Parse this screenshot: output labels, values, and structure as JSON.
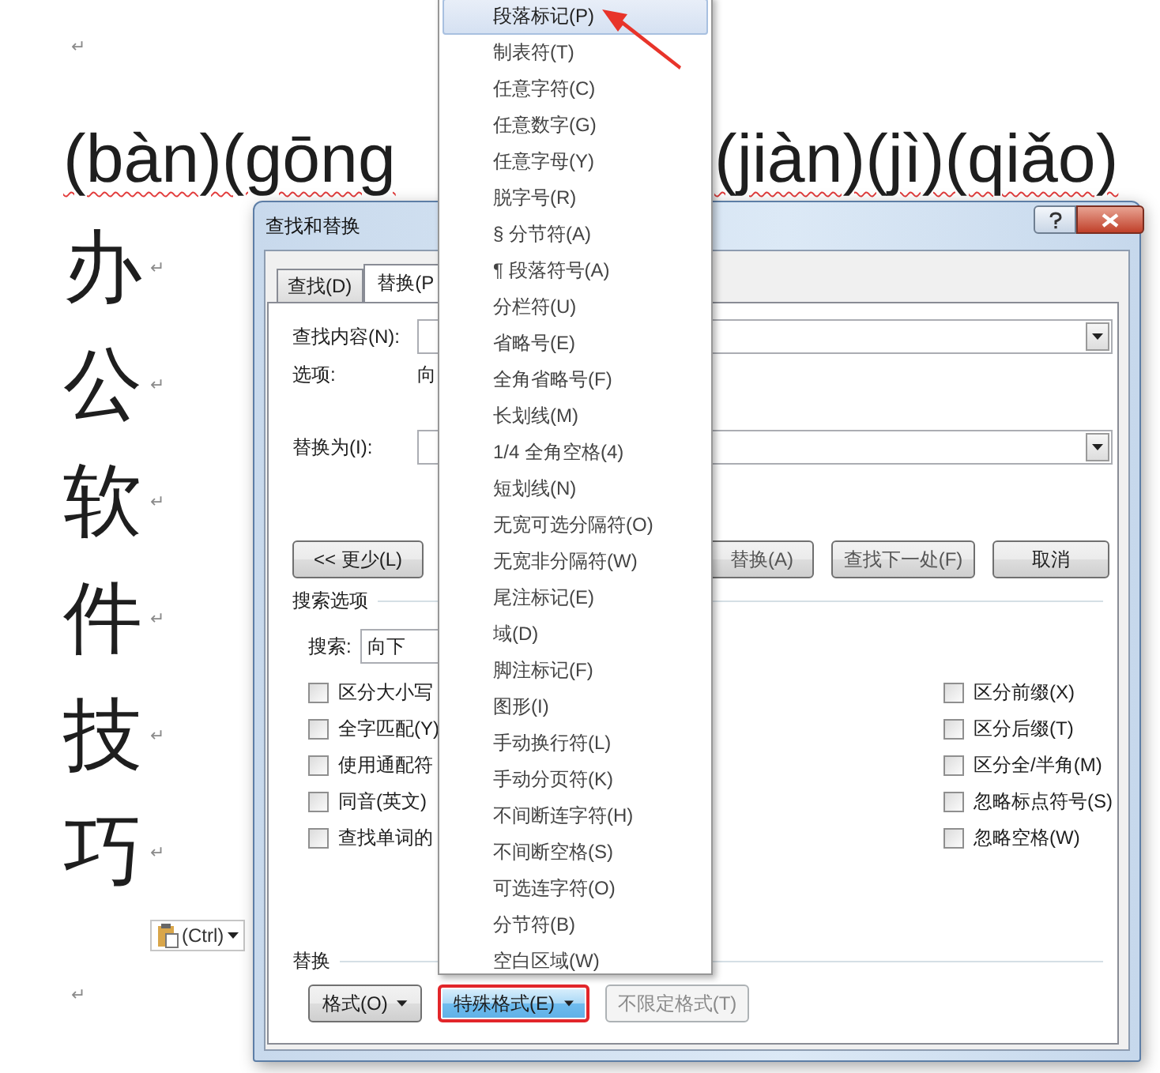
{
  "document": {
    "lines": [
      {
        "kind": "mark",
        "mark": "↵"
      },
      {
        "kind": "pinyin",
        "segments": [
          "(bàn)(gōng",
          "(jiàn)(jì)(qiǎo)"
        ]
      },
      {
        "kind": "char",
        "text": "办",
        "mark": "↵"
      },
      {
        "kind": "char",
        "text": "公",
        "mark": "↵"
      },
      {
        "kind": "char",
        "text": "软",
        "mark": "↵"
      },
      {
        "kind": "char",
        "text": "件",
        "mark": "↵"
      },
      {
        "kind": "char",
        "text": "技",
        "mark": "↵"
      },
      {
        "kind": "char",
        "text": "巧",
        "mark": "↵"
      },
      {
        "kind": "mark",
        "mark": "↵"
      }
    ],
    "paste_options": {
      "label": "(Ctrl)"
    }
  },
  "dialog": {
    "title": "查找和替换",
    "tabs": [
      {
        "label": "查找(D)",
        "selected": false
      },
      {
        "label": "替换(P",
        "selected": true
      }
    ],
    "find": {
      "label": "查找内容(N):"
    },
    "options": {
      "label": "选项:",
      "value": "向"
    },
    "replace": {
      "label": "替换为(I):"
    },
    "buttons": [
      {
        "label": "<< 更少(L)"
      },
      {
        "label": "替换(A)"
      },
      {
        "label": "查找下一处(F)"
      },
      {
        "label": "取消"
      }
    ],
    "search_options": {
      "title": "搜索选项",
      "direction_label": "搜索:",
      "direction": "向下"
    },
    "checkboxes_left": [
      {
        "label": "区分大小写",
        "checked": false
      },
      {
        "label": "全字匹配(Y)",
        "checked": false
      },
      {
        "label": "使用通配符",
        "checked": false
      },
      {
        "label": "同音(英文)",
        "checked": false
      },
      {
        "label": "查找单词的",
        "checked": false
      }
    ],
    "checkboxes_right": [
      {
        "label": "区分前缀(X)",
        "checked": false
      },
      {
        "label": "区分后缀(T)",
        "checked": false
      },
      {
        "label": "区分全/半角(M)",
        "checked": false
      },
      {
        "label": "忽略标点符号(S)",
        "checked": false
      },
      {
        "label": "忽略空格(W)",
        "checked": false
      }
    ],
    "replace_section": {
      "title": "替换",
      "buttons": [
        {
          "label": "格式(O)",
          "kind": "dropdown",
          "pressed": false,
          "disabled": false,
          "annotated": false
        },
        {
          "label": "特殊格式(E)",
          "kind": "dropdown",
          "pressed": true,
          "disabled": false,
          "annotated": true
        },
        {
          "label": "不限定格式(T)",
          "kind": "plain",
          "pressed": false,
          "disabled": true,
          "annotated": false
        }
      ]
    }
  },
  "menu": {
    "items": [
      {
        "label": "段落标记(P)",
        "selected": true
      },
      {
        "label": "制表符(T)",
        "selected": false
      },
      {
        "label": "任意字符(C)",
        "selected": false
      },
      {
        "label": "任意数字(G)",
        "selected": false
      },
      {
        "label": "任意字母(Y)",
        "selected": false
      },
      {
        "label": "脱字号(R)",
        "selected": false
      },
      {
        "label": "§ 分节符(A)",
        "selected": false
      },
      {
        "label": "¶ 段落符号(A)",
        "selected": false
      },
      {
        "label": "分栏符(U)",
        "selected": false
      },
      {
        "label": "省略号(E)",
        "selected": false
      },
      {
        "label": "全角省略号(F)",
        "selected": false
      },
      {
        "label": "长划线(M)",
        "selected": false
      },
      {
        "label": "1/4 全角空格(4)",
        "selected": false
      },
      {
        "label": "短划线(N)",
        "selected": false
      },
      {
        "label": "无宽可选分隔符(O)",
        "selected": false
      },
      {
        "label": "无宽非分隔符(W)",
        "selected": false
      },
      {
        "label": "尾注标记(E)",
        "selected": false
      },
      {
        "label": "域(D)",
        "selected": false
      },
      {
        "label": "脚注标记(F)",
        "selected": false
      },
      {
        "label": "图形(I)",
        "selected": false
      },
      {
        "label": "手动换行符(L)",
        "selected": false
      },
      {
        "label": "手动分页符(K)",
        "selected": false
      },
      {
        "label": "不间断连字符(H)",
        "selected": false
      },
      {
        "label": "不间断空格(S)",
        "selected": false
      },
      {
        "label": "可选连字符(O)",
        "selected": false
      },
      {
        "label": "分节符(B)",
        "selected": false
      },
      {
        "label": "空白区域(W)",
        "selected": false
      }
    ]
  }
}
